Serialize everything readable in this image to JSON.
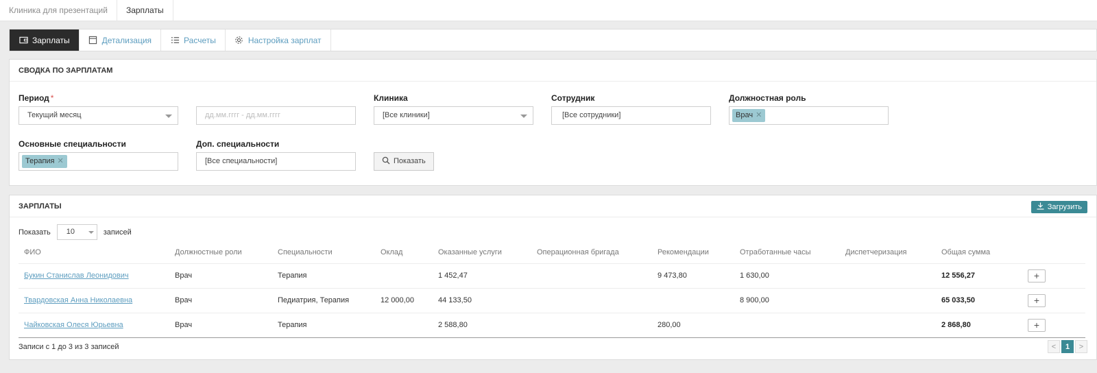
{
  "top_tabs": [
    {
      "label": "Клиника для презентаций",
      "active": false
    },
    {
      "label": "Зарплаты",
      "active": true
    }
  ],
  "nav_tabs": [
    {
      "label": "Зарплаты",
      "icon": "wallet-icon",
      "active": true
    },
    {
      "label": "Детализация",
      "icon": "calendar-icon",
      "active": false
    },
    {
      "label": "Расчеты",
      "icon": "list-icon",
      "active": false
    },
    {
      "label": "Настройка зарплат",
      "icon": "gear-icon",
      "active": false
    }
  ],
  "summary": {
    "title": "СВОДКА ПО ЗАРПЛАТАМ",
    "period_label": "Период",
    "required_mark": "*",
    "period_value": "Текущий месяц",
    "date_placeholder": "дд.мм.гггг - дд.мм.гггг",
    "clinic_label": "Клиника",
    "clinic_value": "[Все клиники]",
    "employee_label": "Сотрудник",
    "employee_value": "[Все сотрудники]",
    "role_label": "Должностная роль",
    "role_tag": "Врач",
    "main_spec_label": "Основные специальности",
    "main_spec_tag": "Терапия",
    "extra_spec_label": "Доп. специальности",
    "extra_spec_value": "[Все специальности]",
    "show_button": "Показать"
  },
  "salaries": {
    "title": "ЗАРПЛАТЫ",
    "upload_button": "Загрузить",
    "show_label": "Показать",
    "page_size": "10",
    "records_label": "записей",
    "columns": [
      "ФИО",
      "Должностные роли",
      "Специальности",
      "Оклад",
      "Оказанные услуги",
      "Операционная бригада",
      "Рекомендации",
      "Отработанные часы",
      "Диспетчеризация",
      "Общая сумма"
    ],
    "rows": [
      {
        "name": "Букин Станислав Леонидович",
        "role": "Врач",
        "spec": "Терапия",
        "salary": "",
        "services": "1 452,47",
        "brigade": "",
        "recommend": "9 473,80",
        "hours": "1 630,00",
        "dispatch": "",
        "total": "12 556,27"
      },
      {
        "name": "Твардовская Анна Николаевна",
        "role": "Врач",
        "spec": "Педиатрия, Терапия",
        "salary": "12 000,00",
        "services": "44 133,50",
        "brigade": "",
        "recommend": "",
        "hours": "8 900,00",
        "dispatch": "",
        "total": "65 033,50"
      },
      {
        "name": "Чайковская Олеся Юрьевна",
        "role": "Врач",
        "spec": "Терапия",
        "salary": "",
        "services": "2 588,80",
        "brigade": "",
        "recommend": "280,00",
        "hours": "",
        "dispatch": "",
        "total": "2 868,80"
      }
    ],
    "info": "Записи с 1 до 3 из 3 записей",
    "pager": {
      "prev": "<",
      "current": "1",
      "next": ">"
    }
  },
  "colors": {
    "accent": "#3b8a95",
    "link": "#5d9dbf",
    "tag": "#9cc9d2",
    "active_tab": "#2b2b2b"
  }
}
